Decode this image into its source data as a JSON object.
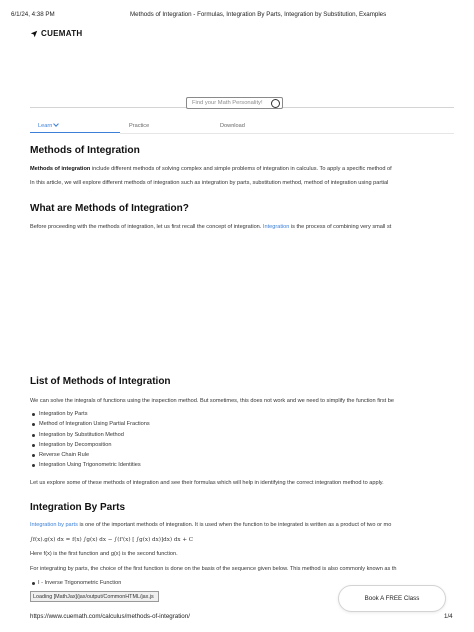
{
  "print_header": {
    "datetime": "6/1/24, 4:38 PM",
    "title": "Methods of Integration - Formulas, Integration By Parts, Integration by Substitution, Examples"
  },
  "brand": {
    "name": "CUEMATH",
    "icon": "rocket-icon"
  },
  "search": {
    "placeholder": "Find your Math Personality!",
    "icon": "circle-icon"
  },
  "tabs": [
    {
      "label": "Learn",
      "active": true
    },
    {
      "label": "Practice",
      "active": false
    },
    {
      "label": "Download",
      "active": false
    }
  ],
  "article": {
    "h1": "Methods of Integration",
    "intro_bold": "Methods of integration",
    "intro_rest": " include different methods of solving complex and simple problems of integration in calculus. To apply a specific method of",
    "intro_p2": "In this article, we will explore different methods of integration such as integration by parts, substitution method, method of integration using partial",
    "h2_what": "What are Methods of Integration?",
    "what_p_before": "Before proceeding with the methods of integration, let us first recall the concept of integration. ",
    "what_p_link": "Integration",
    "what_p_after": " is the process of combining very small st",
    "h2_list": "List of Methods of Integration",
    "list_p": "We can solve the integrals of functions using the inspection method. But sometimes, this does not work and we need to simplify the function first be",
    "list_items": [
      "Integration by Parts",
      "Method of Integration Using Partial Fractions",
      "Integration by Substitution Method",
      "Integration by Decomposition",
      "Reverse Chain Rule",
      "Integration Using Trigonometric Identities"
    ],
    "list_after": "Let us explore some of these methods of integration and see their formulas which will help in identifying the correct integration method to apply.",
    "h2_parts": "Integration By Parts",
    "parts_link": "Integration by parts",
    "parts_p_rest": " is one of the important methods of integration. It is used when the function to be integrated is written as a product of two or mo",
    "parts_formula": "∫f(x).g(x) dx = f(x) ∫g(x) dx − ∫(f'(x) [ ∫g(x) dx)]dx) dx + C",
    "parts_p2": "Here f(x) is the first function and g(x) is the second function.",
    "parts_p3": "For integrating by parts, the choice of the first function is done on the basis of the sequence given below. This method is also commonly known as th",
    "parts_bullet": "I - Inverse Trigonometric Function"
  },
  "loading_text": "Loading [MathJax]/jax/output/CommonHTML/jax.js",
  "cta_label": "Book A FREE Class",
  "print_footer": {
    "url": "https://www.cuemath.com/calculus/methods-of-integration/",
    "page": "1/4"
  }
}
